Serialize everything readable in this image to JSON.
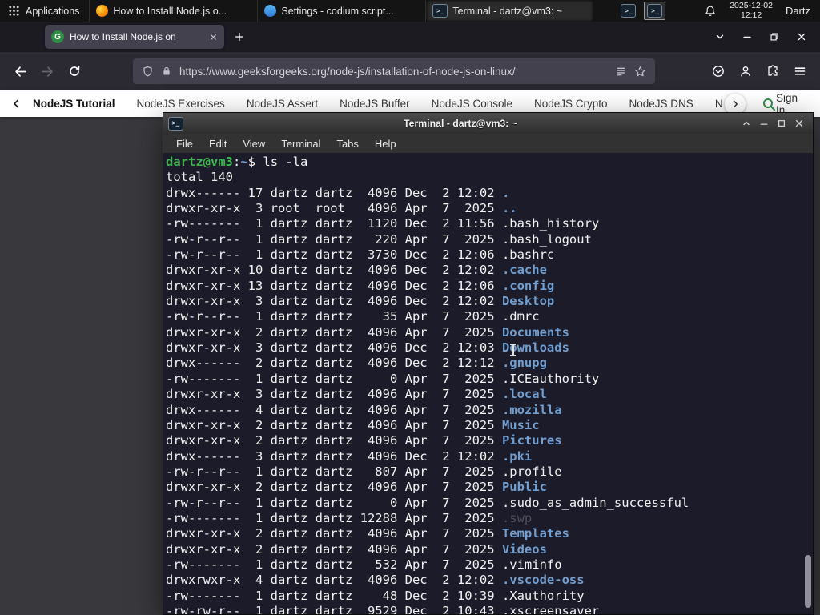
{
  "panel": {
    "applications_label": "Applications",
    "windows": [
      {
        "title": "How to Install Node.js o...",
        "icon": "firefox-icon"
      },
      {
        "title": "Settings - codium script...",
        "icon": "codium-icon"
      },
      {
        "title": "Terminal - dartz@vm3: ~",
        "icon": "terminal-icon"
      }
    ],
    "date": "2025-12-02",
    "time": "12:12",
    "user": "Dartz"
  },
  "browser": {
    "tab_title": "How to Install Node.js on",
    "url": "https://www.geeksforgeeks.org/node-js/installation-of-node-js-on-linux/",
    "site_nav": [
      "NodeJS Tutorial",
      "NodeJS Exercises",
      "NodeJS Assert",
      "NodeJS Buffer",
      "NodeJS Console",
      "NodeJS Crypto",
      "NodeJS DNS",
      "Node"
    ],
    "sign_in_label": "Sign In"
  },
  "terminal": {
    "title": "Terminal - dartz@vm3: ~",
    "menu": [
      "File",
      "Edit",
      "View",
      "Terminal",
      "Tabs",
      "Help"
    ],
    "prompt": {
      "user_host": "dartz@vm3",
      "separator": ":",
      "path": "~",
      "symbol": "$ ",
      "command": "ls -la"
    },
    "total": "total 140",
    "listing": [
      {
        "meta": "drwx------ 17 dartz dartz  4096 Dec  2 12:02 ",
        "name": ".",
        "type": "dir"
      },
      {
        "meta": "drwxr-xr-x  3 root  root   4096 Apr  7  2025 ",
        "name": "..",
        "type": "dir"
      },
      {
        "meta": "-rw-------  1 dartz dartz  1120 Dec  2 11:56 ",
        "name": ".bash_history",
        "type": "file"
      },
      {
        "meta": "-rw-r--r--  1 dartz dartz   220 Apr  7  2025 ",
        "name": ".bash_logout",
        "type": "file"
      },
      {
        "meta": "-rw-r--r--  1 dartz dartz  3730 Dec  2 12:06 ",
        "name": ".bashrc",
        "type": "file"
      },
      {
        "meta": "drwxr-xr-x 10 dartz dartz  4096 Dec  2 12:02 ",
        "name": ".cache",
        "type": "dir"
      },
      {
        "meta": "drwxr-xr-x 13 dartz dartz  4096 Dec  2 12:06 ",
        "name": ".config",
        "type": "dir"
      },
      {
        "meta": "drwxr-xr-x  3 dartz dartz  4096 Dec  2 12:02 ",
        "name": "Desktop",
        "type": "dir"
      },
      {
        "meta": "-rw-r--r--  1 dartz dartz    35 Apr  7  2025 ",
        "name": ".dmrc",
        "type": "file"
      },
      {
        "meta": "drwxr-xr-x  2 dartz dartz  4096 Apr  7  2025 ",
        "name": "Documents",
        "type": "dir"
      },
      {
        "meta": "drwxr-xr-x  3 dartz dartz  4096 Dec  2 12:03 ",
        "name": "Downloads",
        "type": "dir"
      },
      {
        "meta": "drwx------  2 dartz dartz  4096 Dec  2 12:12 ",
        "name": ".gnupg",
        "type": "dir"
      },
      {
        "meta": "-rw-------  1 dartz dartz     0 Apr  7  2025 ",
        "name": ".ICEauthority",
        "type": "file"
      },
      {
        "meta": "drwxr-xr-x  3 dartz dartz  4096 Apr  7  2025 ",
        "name": ".local",
        "type": "dir"
      },
      {
        "meta": "drwx------  4 dartz dartz  4096 Apr  7  2025 ",
        "name": ".mozilla",
        "type": "dir"
      },
      {
        "meta": "drwxr-xr-x  2 dartz dartz  4096 Apr  7  2025 ",
        "name": "Music",
        "type": "dir"
      },
      {
        "meta": "drwxr-xr-x  2 dartz dartz  4096 Apr  7  2025 ",
        "name": "Pictures",
        "type": "dir"
      },
      {
        "meta": "drwx------  3 dartz dartz  4096 Dec  2 12:02 ",
        "name": ".pki",
        "type": "dir"
      },
      {
        "meta": "-rw-r--r--  1 dartz dartz   807 Apr  7  2025 ",
        "name": ".profile",
        "type": "file"
      },
      {
        "meta": "drwxr-xr-x  2 dartz dartz  4096 Apr  7  2025 ",
        "name": "Public",
        "type": "dir"
      },
      {
        "meta": "-rw-r--r--  1 dartz dartz     0 Apr  7  2025 ",
        "name": ".sudo_as_admin_successful",
        "type": "file"
      },
      {
        "meta": "-rw-------  1 dartz dartz 12288 Apr  7  2025 ",
        "name": ".swp",
        "type": "dim"
      },
      {
        "meta": "drwxr-xr-x  2 dartz dartz  4096 Apr  7  2025 ",
        "name": "Templates",
        "type": "dir"
      },
      {
        "meta": "drwxr-xr-x  2 dartz dartz  4096 Apr  7  2025 ",
        "name": "Videos",
        "type": "dir"
      },
      {
        "meta": "-rw-------  1 dartz dartz   532 Apr  7  2025 ",
        "name": ".viminfo",
        "type": "file"
      },
      {
        "meta": "drwxrwxr-x  4 dartz dartz  4096 Dec  2 12:02 ",
        "name": ".vscode-oss",
        "type": "dir"
      },
      {
        "meta": "-rw-------  1 dartz dartz    48 Dec  2 10:39 ",
        "name": ".Xauthority",
        "type": "file"
      },
      {
        "meta": "-rw-rw-r--  1 dartz dartz  9529 Dec  2 10:43 ",
        "name": ".xscreensaver",
        "type": "file"
      }
    ]
  },
  "colors": {
    "gfg_green": "#2f8d46",
    "directory_blue": "#729fcf",
    "prompt_green": "#3eb34f",
    "dim_file_gray": "#4f4f5e"
  }
}
